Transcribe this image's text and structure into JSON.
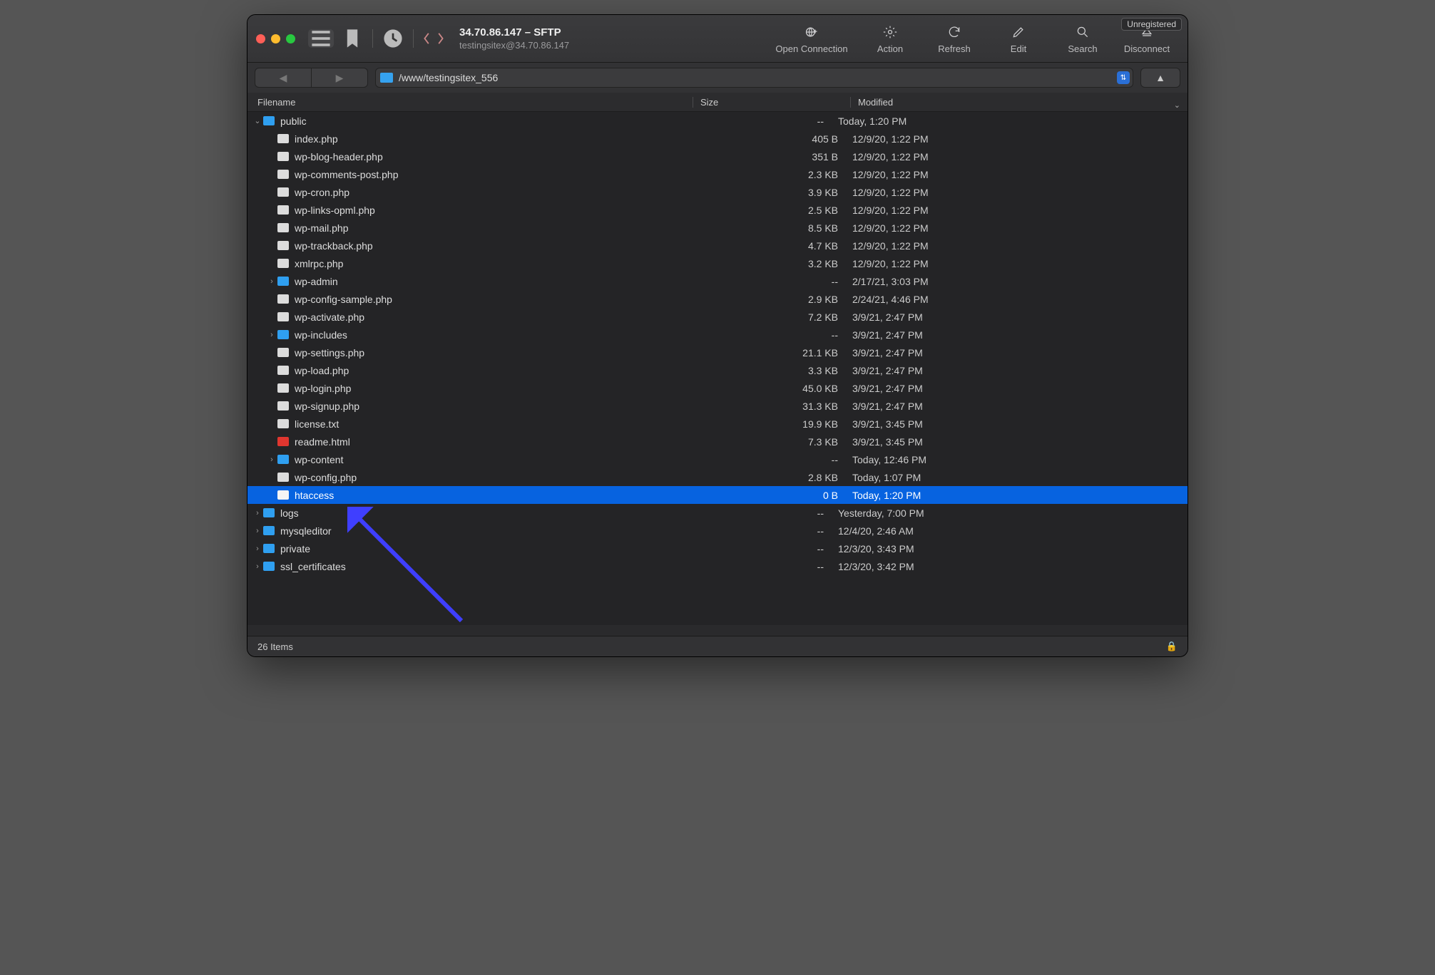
{
  "unregistered_label": "Unregistered",
  "title": "34.70.86.147 – SFTP",
  "subtitle": "testingsitex@34.70.86.147",
  "toolbar": {
    "open": "Open Connection",
    "action": "Action",
    "refresh": "Refresh",
    "edit": "Edit",
    "search": "Search",
    "disconnect": "Disconnect"
  },
  "path": "/www/testingsitex_556",
  "columns": {
    "name": "Filename",
    "size": "Size",
    "modified": "Modified"
  },
  "status": "26 Items",
  "rows": [
    {
      "depth": 0,
      "exp": "open",
      "type": "folder",
      "name": "public",
      "size": "--",
      "mod": "Today, 1:20 PM",
      "sel": false
    },
    {
      "depth": 1,
      "exp": "",
      "type": "file",
      "name": "index.php",
      "size": "405 B",
      "mod": "12/9/20, 1:22 PM",
      "sel": false
    },
    {
      "depth": 1,
      "exp": "",
      "type": "file",
      "name": "wp-blog-header.php",
      "size": "351 B",
      "mod": "12/9/20, 1:22 PM",
      "sel": false
    },
    {
      "depth": 1,
      "exp": "",
      "type": "file",
      "name": "wp-comments-post.php",
      "size": "2.3 KB",
      "mod": "12/9/20, 1:22 PM",
      "sel": false
    },
    {
      "depth": 1,
      "exp": "",
      "type": "file",
      "name": "wp-cron.php",
      "size": "3.9 KB",
      "mod": "12/9/20, 1:22 PM",
      "sel": false
    },
    {
      "depth": 1,
      "exp": "",
      "type": "file",
      "name": "wp-links-opml.php",
      "size": "2.5 KB",
      "mod": "12/9/20, 1:22 PM",
      "sel": false
    },
    {
      "depth": 1,
      "exp": "",
      "type": "file",
      "name": "wp-mail.php",
      "size": "8.5 KB",
      "mod": "12/9/20, 1:22 PM",
      "sel": false
    },
    {
      "depth": 1,
      "exp": "",
      "type": "file",
      "name": "wp-trackback.php",
      "size": "4.7 KB",
      "mod": "12/9/20, 1:22 PM",
      "sel": false
    },
    {
      "depth": 1,
      "exp": "",
      "type": "file",
      "name": "xmlrpc.php",
      "size": "3.2 KB",
      "mod": "12/9/20, 1:22 PM",
      "sel": false
    },
    {
      "depth": 1,
      "exp": "closed",
      "type": "folder",
      "name": "wp-admin",
      "size": "--",
      "mod": "2/17/21, 3:03 PM",
      "sel": false
    },
    {
      "depth": 1,
      "exp": "",
      "type": "file",
      "name": "wp-config-sample.php",
      "size": "2.9 KB",
      "mod": "2/24/21, 4:46 PM",
      "sel": false
    },
    {
      "depth": 1,
      "exp": "",
      "type": "file",
      "name": "wp-activate.php",
      "size": "7.2 KB",
      "mod": "3/9/21, 2:47 PM",
      "sel": false
    },
    {
      "depth": 1,
      "exp": "closed",
      "type": "folder",
      "name": "wp-includes",
      "size": "--",
      "mod": "3/9/21, 2:47 PM",
      "sel": false
    },
    {
      "depth": 1,
      "exp": "",
      "type": "file",
      "name": "wp-settings.php",
      "size": "21.1 KB",
      "mod": "3/9/21, 2:47 PM",
      "sel": false
    },
    {
      "depth": 1,
      "exp": "",
      "type": "file",
      "name": "wp-load.php",
      "size": "3.3 KB",
      "mod": "3/9/21, 2:47 PM",
      "sel": false
    },
    {
      "depth": 1,
      "exp": "",
      "type": "file",
      "name": "wp-login.php",
      "size": "45.0 KB",
      "mod": "3/9/21, 2:47 PM",
      "sel": false
    },
    {
      "depth": 1,
      "exp": "",
      "type": "file",
      "name": "wp-signup.php",
      "size": "31.3 KB",
      "mod": "3/9/21, 2:47 PM",
      "sel": false
    },
    {
      "depth": 1,
      "exp": "",
      "type": "file",
      "name": "license.txt",
      "size": "19.9 KB",
      "mod": "3/9/21, 3:45 PM",
      "sel": false
    },
    {
      "depth": 1,
      "exp": "",
      "type": "html",
      "name": "readme.html",
      "size": "7.3 KB",
      "mod": "3/9/21, 3:45 PM",
      "sel": false
    },
    {
      "depth": 1,
      "exp": "closed",
      "type": "folder",
      "name": "wp-content",
      "size": "--",
      "mod": "Today, 12:46 PM",
      "sel": false
    },
    {
      "depth": 1,
      "exp": "",
      "type": "file",
      "name": "wp-config.php",
      "size": "2.8 KB",
      "mod": "Today, 1:07 PM",
      "sel": false
    },
    {
      "depth": 1,
      "exp": "",
      "type": "file",
      "name": "htaccess",
      "size": "0 B",
      "mod": "Today, 1:20 PM",
      "sel": true
    },
    {
      "depth": 0,
      "exp": "closed",
      "type": "folder",
      "name": "logs",
      "size": "--",
      "mod": "Yesterday, 7:00 PM",
      "sel": false
    },
    {
      "depth": 0,
      "exp": "closed",
      "type": "folder",
      "name": "mysqleditor",
      "size": "--",
      "mod": "12/4/20, 2:46 AM",
      "sel": false
    },
    {
      "depth": 0,
      "exp": "closed",
      "type": "folder",
      "name": "private",
      "size": "--",
      "mod": "12/3/20, 3:43 PM",
      "sel": false
    },
    {
      "depth": 0,
      "exp": "closed",
      "type": "folder",
      "name": "ssl_certificates",
      "size": "--",
      "mod": "12/3/20, 3:42 PM",
      "sel": false
    }
  ]
}
